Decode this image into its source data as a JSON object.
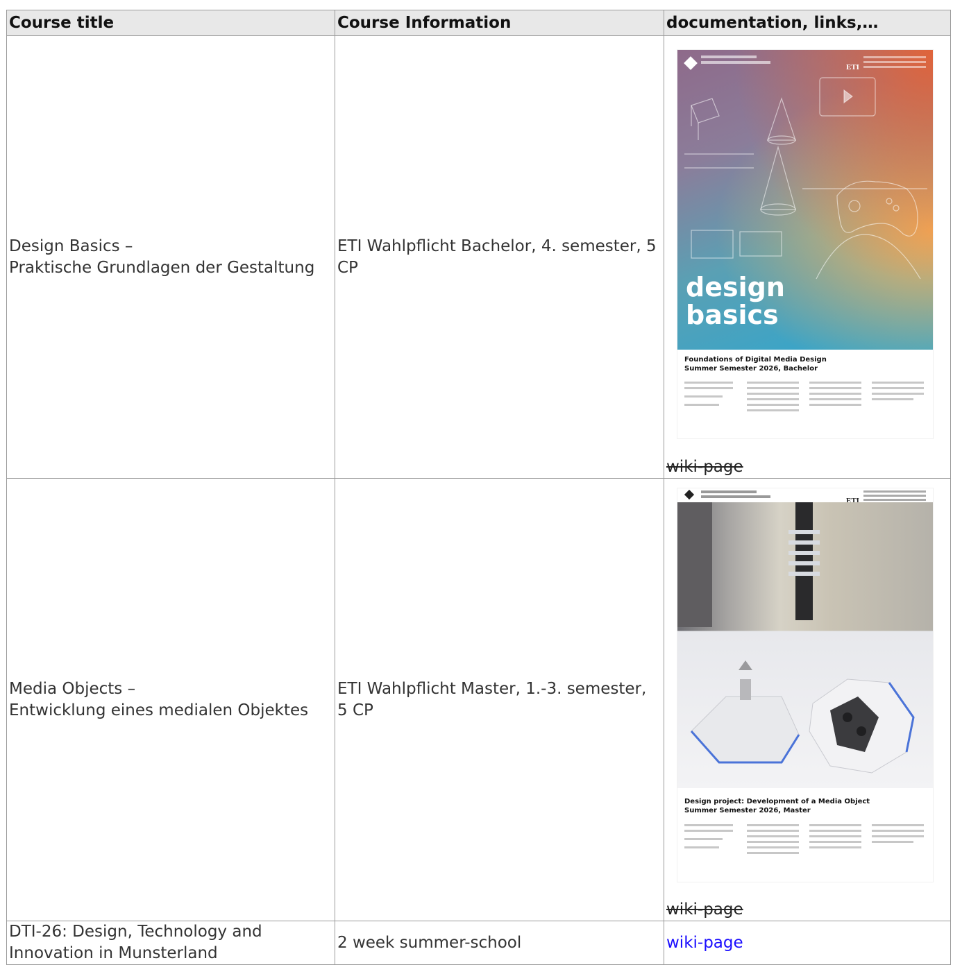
{
  "table": {
    "headers": [
      "Course title",
      "Course Information",
      "documentation, links,…"
    ],
    "rows": [
      {
        "title_line1": "Design Basics –",
        "title_line2": "Praktische Grundlagen der Gestaltung",
        "info": "ETI Wahlpflicht Bachelor, 4. semester, 5 CP",
        "poster": {
          "title_line1": "design",
          "title_line2": "basics",
          "subtitle_line1": "Foundations of Digital Media Design",
          "subtitle_line2": "Summer Semester 2026, Bachelor",
          "header_mark": "ETI"
        },
        "link_label": "wiki-page"
      },
      {
        "title_line1": "Media Objects –",
        "title_line2": "Entwicklung eines medialen Objektes",
        "info": "ETI Wahlpflicht Master, 1.-3. semester, 5 CP",
        "poster": {
          "subtitle_line1": "Design project: Development of a Media Object",
          "subtitle_line2": "Summer Semester 2026, Master",
          "header_mark": "ETI"
        },
        "link_label": "wiki-page"
      },
      {
        "title_line1": "DTI-26: Design, Technology and",
        "title_line2": "Innovation in Munsterland",
        "info": "2 week summer-school",
        "link_label": "wiki-page"
      }
    ]
  },
  "colors": {
    "link": "#1a0dff",
    "header_bg": "#e8e8e8",
    "border": "#9a9a9a"
  }
}
